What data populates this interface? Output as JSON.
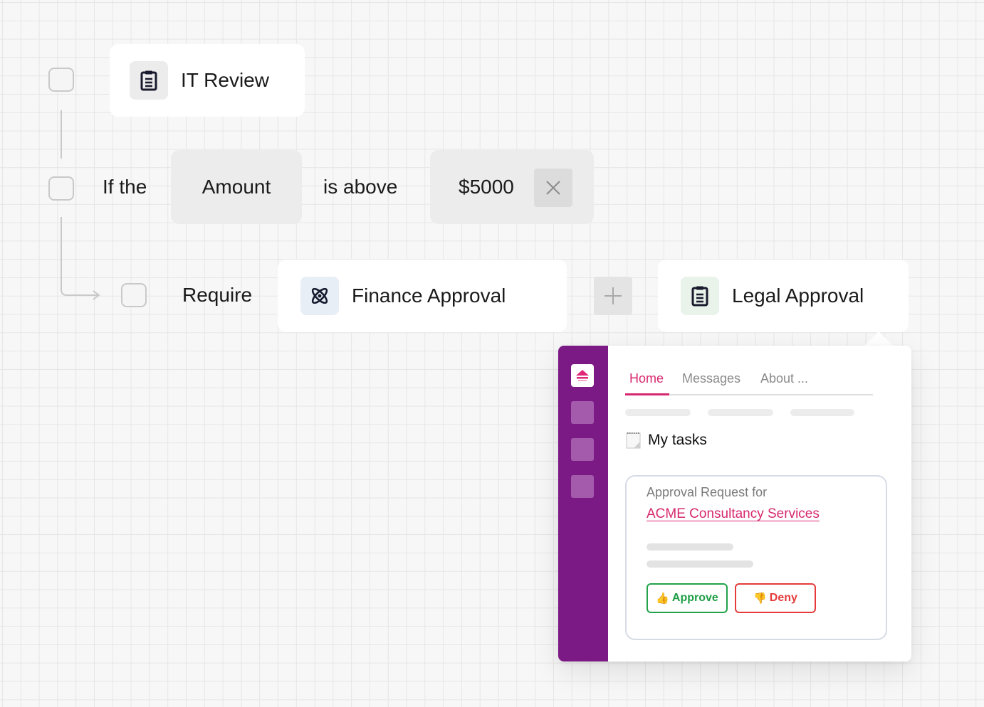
{
  "workflow": {
    "step1": {
      "title": "IT Review",
      "icon": "clipboard-icon"
    },
    "condition": {
      "prefix": "If the",
      "field": "Amount",
      "operator": "is above",
      "value": "$5000",
      "clear_icon": "close-icon"
    },
    "require": {
      "label": "Require",
      "approval1": {
        "title": "Finance Approval",
        "icon": "atom-icon"
      },
      "add_icon": "plus-icon",
      "approval2": {
        "title": "Legal Approval",
        "icon": "clipboard-icon"
      }
    }
  },
  "panel": {
    "tabs": [
      {
        "label": "Home",
        "active": true
      },
      {
        "label": "Messages",
        "active": false
      },
      {
        "label": "About ...",
        "active": false
      }
    ],
    "tasks_icon": "notepad-icon",
    "tasks_title": "My tasks",
    "task": {
      "subtitle": "Approval Request for",
      "link": "ACME Consultancy Services",
      "approve_label": "Approve",
      "approve_emoji": "👍",
      "deny_label": "Deny",
      "deny_emoji": "👎"
    }
  },
  "colors": {
    "sidebar": "#7b1a84",
    "accent": "#d6286e",
    "approve": "#1f9e45",
    "deny": "#e53b3b"
  }
}
